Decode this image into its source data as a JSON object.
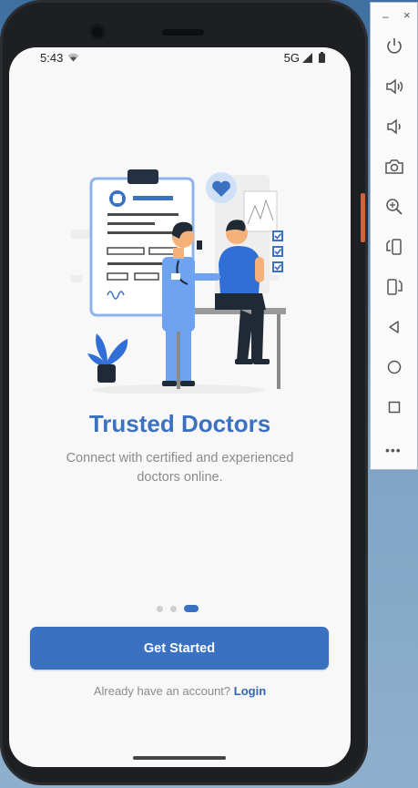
{
  "status_bar": {
    "time": "5:43",
    "network": "5G"
  },
  "onboarding": {
    "title": "Trusted Doctors",
    "subtitle": "Connect with certified and experienced doctors online.",
    "page_count": 3,
    "active_page": 3,
    "cta_label": "Get Started",
    "login_prompt": "Already have an account?",
    "login_link": "Login"
  },
  "emulator_toolbar": {
    "minimize_label": "–",
    "close_label": "×",
    "buttons": [
      "power-icon",
      "volume-up-icon",
      "volume-down-icon",
      "camera-icon",
      "zoom-icon",
      "rotate-left-icon",
      "rotate-right-icon",
      "back-icon",
      "home-icon",
      "overview-icon"
    ],
    "more_label": "•••"
  },
  "colors": {
    "accent": "#3a71c1",
    "screen_bg": "#f8f8f8",
    "muted_text": "#8b8b8b"
  }
}
